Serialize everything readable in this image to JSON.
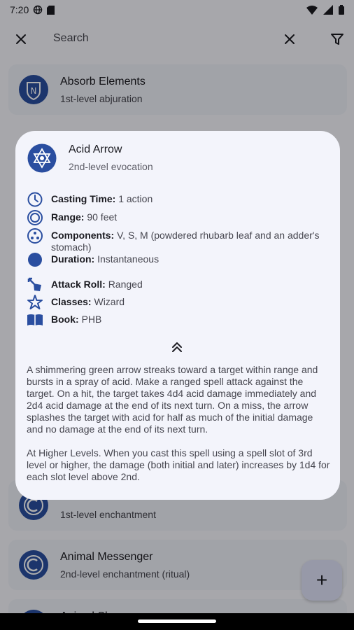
{
  "status_bar": {
    "time": "7:20"
  },
  "app_bar": {
    "search_placeholder": "Search"
  },
  "list": [
    {
      "title": "Absorb Elements",
      "subtitle": "1st-level abjuration"
    },
    {
      "title": "",
      "subtitle": "1st-level enchantment"
    },
    {
      "title": "Animal Messenger",
      "subtitle": "2nd-level enchantment (ritual)"
    },
    {
      "title": "Animal Shapes",
      "subtitle": ""
    }
  ],
  "fab": {
    "label": "+"
  },
  "dialog": {
    "title": "Acid Arrow",
    "subtitle": "2nd-level evocation",
    "properties": [
      {
        "icon": "clock-icon",
        "label": "Casting Time:",
        "value": "1 action"
      },
      {
        "icon": "range-icon",
        "label": "Range:",
        "value": "90 feet"
      },
      {
        "icon": "components-icon",
        "label": "Components:",
        "value": "V, S, M (powdered rhubarb leaf and an adder's stomach)"
      },
      {
        "icon": "duration-icon",
        "label": "Duration:",
        "value": "Instantaneous"
      },
      {
        "icon": "attack-roll-icon",
        "label": "Attack Roll:",
        "value": "Ranged"
      },
      {
        "icon": "classes-icon",
        "label": "Classes:",
        "value": "Wizard"
      },
      {
        "icon": "book-icon",
        "label": "Book:",
        "value": "PHB"
      }
    ],
    "description": "A shimmering green arrow streaks toward a target within range and bursts in a spray of acid. Make a ranged spell attack against the target. On a hit, the target takes 4d4 acid damage immediately and 2d4 acid damage at the end of its next turn. On a miss, the arrow splashes the target with acid for half as much of the initial damage and no damage at the end of its next turn.",
    "higher_levels": "At Higher Levels. When you cast this spell using a spell slot of 3rd level or higher, the damage (both initial and later) increases by 1d4 for each slot level above 2nd."
  },
  "colors": {
    "accent": "#2a4ea0",
    "scrim": "rgba(0,0,0,0.32)",
    "dialog_bg": "#f3f4fb"
  }
}
